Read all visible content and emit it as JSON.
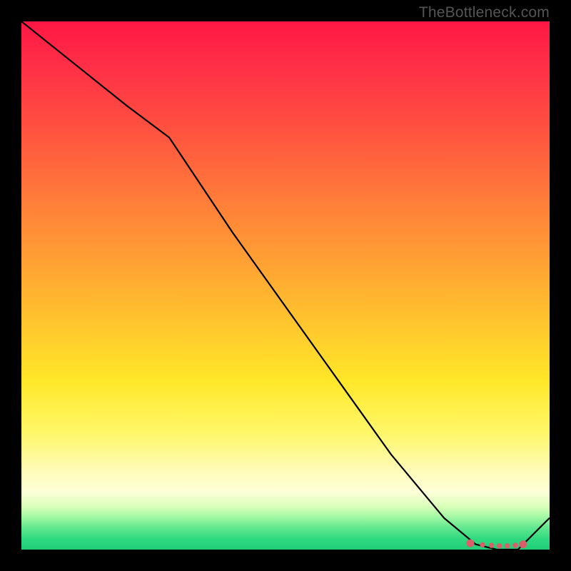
{
  "watermark": "TheBottleneck.com",
  "chart_data": {
    "type": "line",
    "title": "",
    "xlabel": "",
    "ylabel": "",
    "xlim": [
      0,
      100
    ],
    "ylim": [
      0,
      100
    ],
    "grid": false,
    "legend": false,
    "series": [
      {
        "name": "bottleneck-curve",
        "x": [
          0,
          10,
          20,
          28,
          40,
          50,
          60,
          70,
          80,
          86,
          90,
          94,
          100
        ],
        "y": [
          100,
          92,
          84,
          78,
          60,
          46,
          32,
          18,
          6,
          1,
          0,
          0,
          6
        ]
      }
    ],
    "highlight_points": {
      "name": "sweet-spot-dots",
      "x": [
        85,
        87.3,
        89,
        90.5,
        92,
        93.5,
        95
      ],
      "y": [
        1.2,
        0.9,
        0.8,
        0.7,
        0.7,
        0.8,
        1.0
      ]
    },
    "colors": {
      "curve": "#000000",
      "dots": "#d9606a",
      "gradient_top": "#ff1744",
      "gradient_mid": "#ffe728",
      "gradient_bottom": "#1fce78",
      "frame": "#000000"
    }
  }
}
